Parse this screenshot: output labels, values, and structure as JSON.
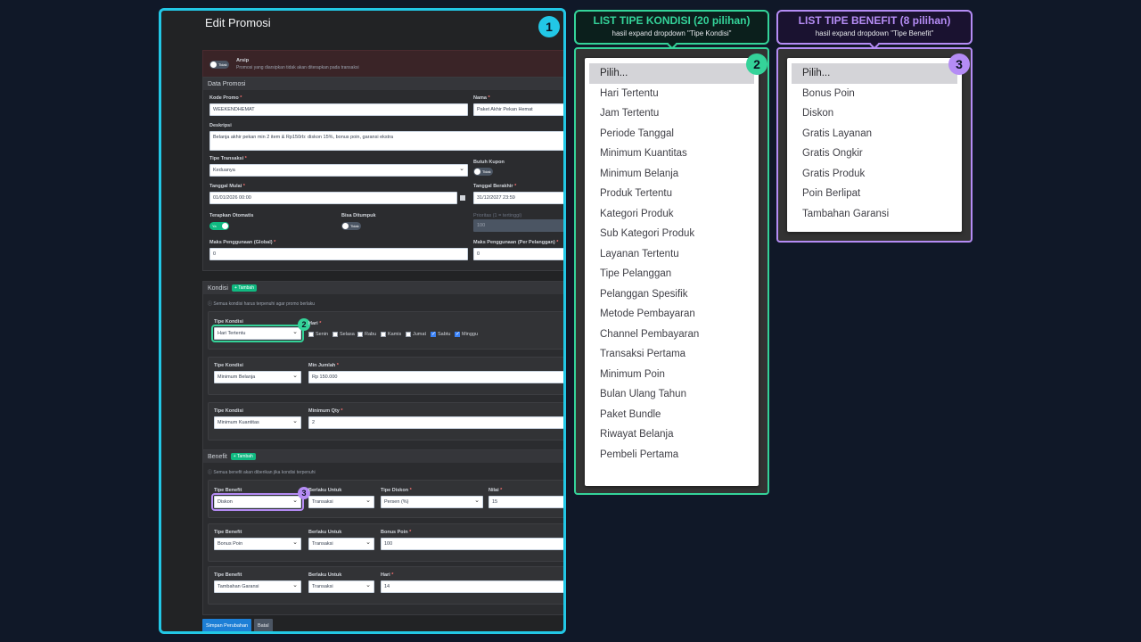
{
  "form": {
    "title": "Edit Promosi",
    "archive": {
      "label": "Arsip",
      "toggle": "Tidak",
      "note": "Promosi yang diarsipkan tidak akan diterapkan pada transaksi"
    },
    "data_promosi": {
      "heading": "Data Promosi",
      "kode_label": "Kode Promo",
      "kode_value": "WEEKENDHEMAT",
      "nama_label": "Nama",
      "nama_value": "Paket Akhir Pekan Hemat",
      "deskripsi_label": "Deskripsi",
      "deskripsi_value": "Belanja akhir pekan min 2 item & Rp150rb: diskon 15%, bonus poin, garansi ekstra",
      "tipe_transaksi_label": "Tipe Transaksi",
      "tipe_transaksi_value": "Keduanya",
      "butuh_kupon_label": "Butuh Kupon",
      "butuh_kupon_toggle": "Tidak",
      "tanggal_mulai_label": "Tanggal Mulai",
      "tanggal_mulai_value": "01/01/2026 00:00",
      "tanggal_berakhir_label": "Tanggal Berakhir",
      "tanggal_berakhir_value": "31/12/2027 23:59",
      "terapkan_label": "Terapkan Otomatis",
      "terapkan_toggle": "Ya",
      "bisa_ditumpuk_label": "Bisa Ditumpuk",
      "bisa_ditumpuk_toggle": "Tidak",
      "prioritas_label": "Prioritas (1 = tertinggi)",
      "prioritas_value": "100",
      "maks_global_label": "Maks Penggunaan (Global)",
      "maks_global_value": "0",
      "maks_pelanggan_label": "Maks Penggunaan (Per Pelanggan)",
      "maks_pelanggan_value": "0"
    },
    "kondisi": {
      "heading": "Kondisi",
      "add_label": "+ Tambah",
      "note": "Semua kondisi harus terpenuhi agar promo berlaku",
      "rows": [
        {
          "type_label": "Tipe Kondisi",
          "type_value": "Hari Tertentu",
          "field_label": "Hari"
        },
        {
          "type_label": "Tipe Kondisi",
          "type_value": "Minimum Belanja",
          "field_label": "Min Jumlah",
          "field_value": "Rp 150.000"
        },
        {
          "type_label": "Tipe Kondisi",
          "type_value": "Minimum Kuantitas",
          "field_label": "Minimum Qty",
          "field_value": "2"
        }
      ],
      "days": [
        {
          "label": "Senin",
          "checked": false
        },
        {
          "label": "Selasa",
          "checked": false
        },
        {
          "label": "Rabu",
          "checked": false
        },
        {
          "label": "Kamis",
          "checked": false
        },
        {
          "label": "Jumat",
          "checked": false
        },
        {
          "label": "Sabtu",
          "checked": true
        },
        {
          "label": "Minggu",
          "checked": true
        }
      ]
    },
    "benefit": {
      "heading": "Benefit",
      "add_label": "+ Tambah",
      "note": "Semua benefit akan diberikan jika kondisi terpenuhi",
      "rows": [
        {
          "type_label": "Tipe Benefit",
          "type_value": "Diskon",
          "for_label": "Berlaku Untuk",
          "for_value": "Transaksi",
          "disc_label": "Tipe Diskon",
          "disc_value": "Persen (%)",
          "val_label": "Nilai",
          "val_value": "15"
        },
        {
          "type_label": "Tipe Benefit",
          "type_value": "Bonus Poin",
          "for_label": "Berlaku Untuk",
          "for_value": "Transaksi",
          "val_label": "Bonus Poin",
          "val_value": "100"
        },
        {
          "type_label": "Tipe Benefit",
          "type_value": "Tambahan Garansi",
          "for_label": "Berlaku Untuk",
          "for_value": "Transaksi",
          "val_label": "Hari",
          "val_value": "14"
        }
      ]
    },
    "save_label": "Simpan Perubahan",
    "cancel_label": "Batal"
  },
  "badges": {
    "one": "1",
    "two": "2",
    "three": "3"
  },
  "list_kondisi": {
    "title": "LIST TIPE KONDISI (20 pilihan)",
    "subtitle": "hasil expand dropdown \"Tipe Kondisi\"",
    "options": [
      "Pilih...",
      "Hari Tertentu",
      "Jam Tertentu",
      "Periode Tanggal",
      "Minimum Kuantitas",
      "Minimum Belanja",
      "Produk Tertentu",
      "Kategori Produk",
      "Sub Kategori Produk",
      "Layanan Tertentu",
      "Tipe Pelanggan",
      "Pelanggan Spesifik",
      "Metode Pembayaran",
      "Channel Pembayaran",
      "Transaksi Pertama",
      "Minimum Poin",
      "Bulan Ulang Tahun",
      "Paket Bundle",
      "Riwayat Belanja",
      "Pembeli Pertama"
    ]
  },
  "list_benefit": {
    "title": "LIST TIPE BENEFIT (8 pilihan)",
    "subtitle": "hasil expand dropdown \"Tipe Benefit\"",
    "options": [
      "Pilih...",
      "Bonus Poin",
      "Diskon",
      "Gratis Layanan",
      "Gratis Ongkir",
      "Gratis Produk",
      "Poin Berlipat",
      "Tambahan Garansi"
    ]
  },
  "colors": {
    "cyan": "#22c7e6",
    "green": "#34d399",
    "purple": "#b58cf5"
  }
}
